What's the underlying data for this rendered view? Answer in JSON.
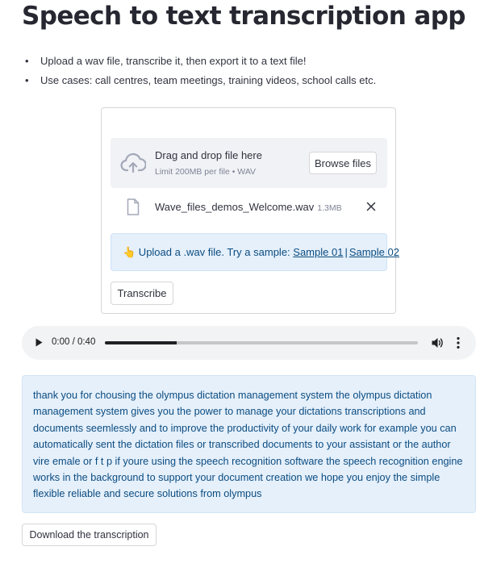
{
  "page": {
    "title": "Speech to text transcription app",
    "bullets": [
      "Upload a wav file, transcribe it, then export it to a text file!",
      "Use cases: call centres, team meetings, training videos, school calls etc."
    ]
  },
  "uploader": {
    "drop_label": "Drag and drop file here",
    "limit_label": "Limit 200MB per file • WAV",
    "browse_label": "Browse files",
    "file": {
      "name": "Wave_files_demos_Welcome.wav",
      "size": "1.3MB"
    }
  },
  "info": {
    "emoji": "👆",
    "text": " Upload a .wav file. Try a sample: ",
    "links": [
      "Sample 01",
      "Sample 02"
    ],
    "separator": "|"
  },
  "transcribe_label": "Transcribe",
  "audio": {
    "time": "0:00 / 0:40",
    "progress_fraction": 0.23
  },
  "transcript": "thank you for chousing the olympus dictation management system the olympus dictation management system gives you the power to manage your dictations transcriptions and documents seemlessly and to improve the productivity of your daily work for example you can automatically sent the dictation files or transcribed documents to your assistant or the author vire emale or f t p if youre using the speech recognition software the speech recognition engine works in the background to support your document creation we hope you enjoy the simple flexible reliable and secure solutions from olympus",
  "download_label": "Download the transcription",
  "colors": {
    "info_bg": "#e5f0fb",
    "info_text": "#0c4c80",
    "dropzone_bg": "#f0f2f6",
    "player_bg": "#f1f3f4"
  },
  "icons": {
    "upload": "cloud-upload-icon",
    "file": "file-icon",
    "close": "close-icon",
    "play": "play-icon",
    "volume": "volume-icon",
    "more": "more-vertical-icon"
  }
}
